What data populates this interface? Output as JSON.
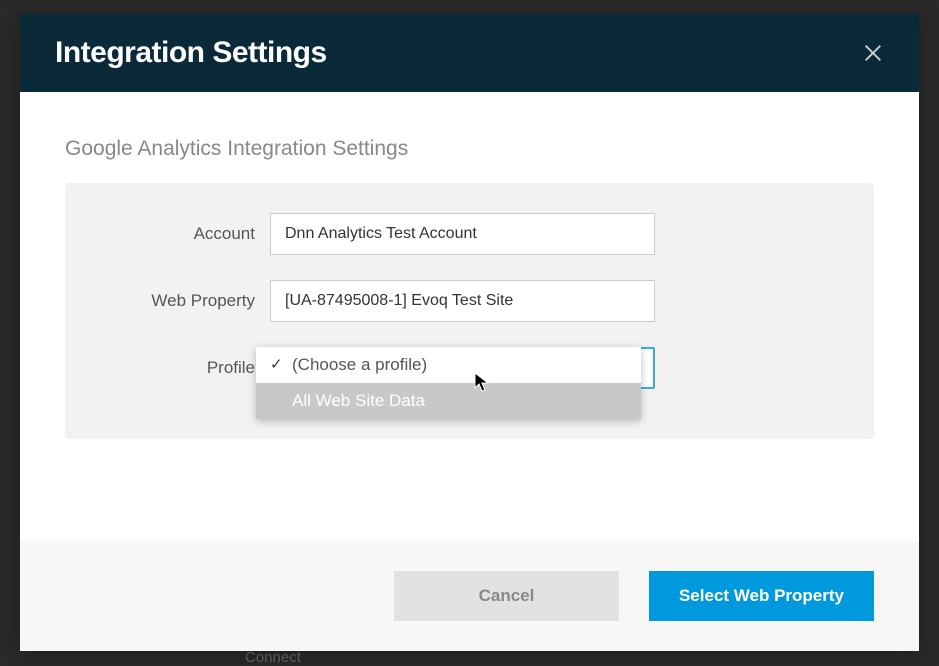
{
  "modal": {
    "title": "Integration Settings",
    "section_title": "Google Analytics Integration Settings"
  },
  "form": {
    "account": {
      "label": "Account",
      "value": "Dnn Analytics Test Account"
    },
    "web_property": {
      "label": "Web Property",
      "value": "[UA-87495008-1] Evoq Test Site"
    },
    "profile": {
      "label": "Profile",
      "options": [
        {
          "label": "(Choose a profile)",
          "selected": true
        },
        {
          "label": "All Web Site Data",
          "highlighted": true
        }
      ]
    }
  },
  "footer": {
    "cancel_label": "Cancel",
    "primary_label": "Select Web Property"
  },
  "background": {
    "connect_hint": "Connect"
  }
}
